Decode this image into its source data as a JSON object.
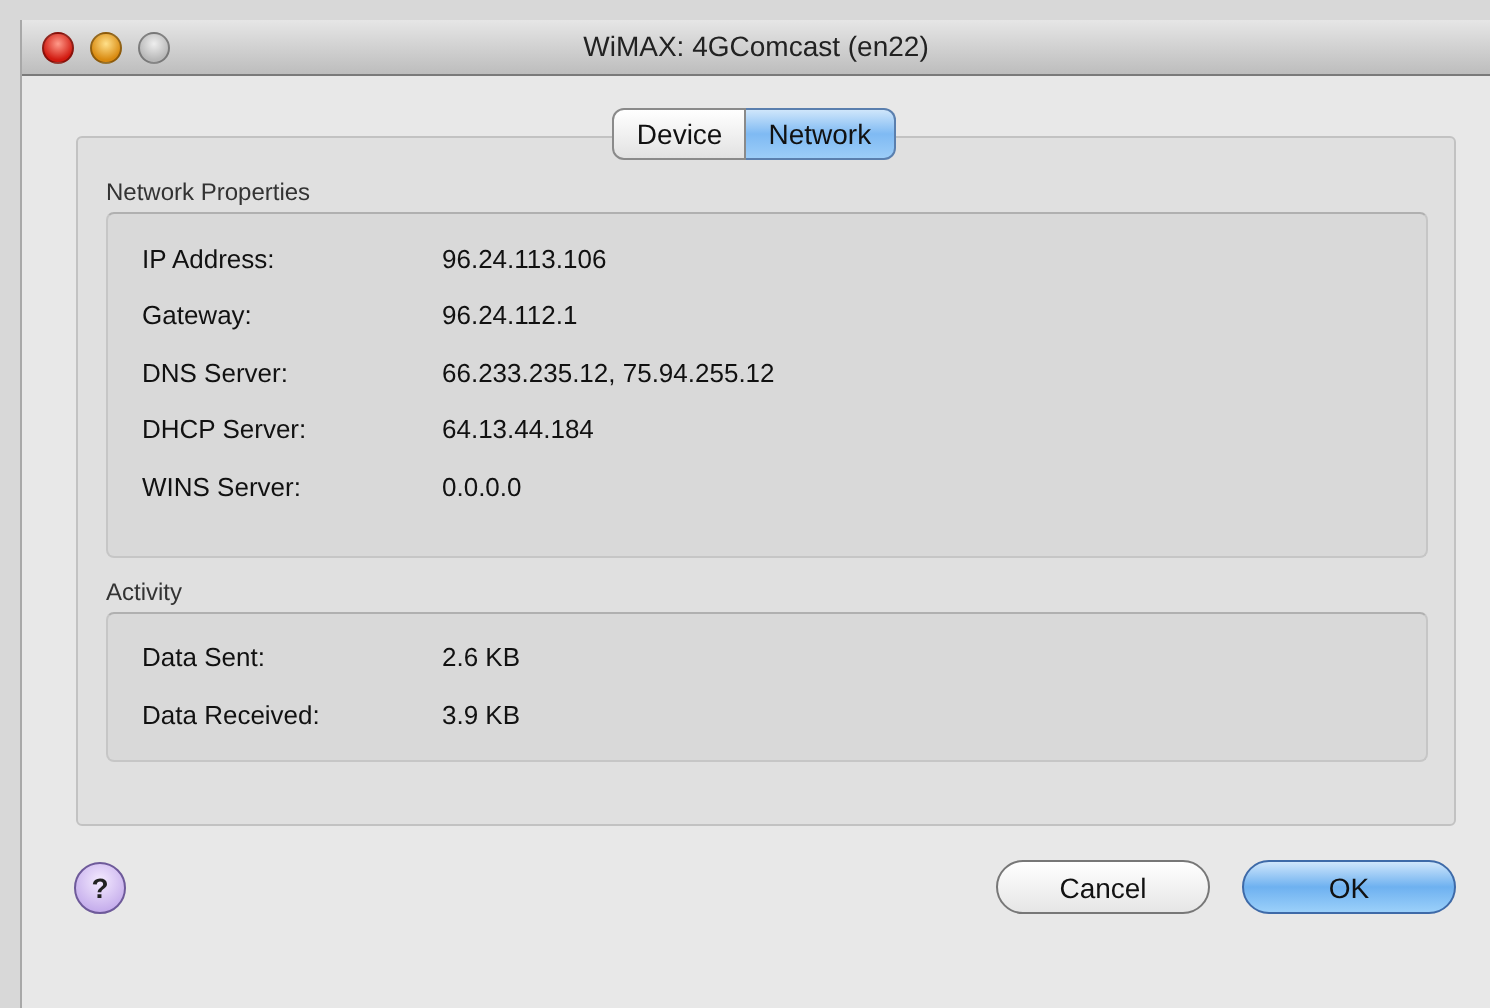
{
  "window": {
    "title": "WiMAX: 4GComcast (en22)"
  },
  "tabs": [
    {
      "label": "Device",
      "selected": false
    },
    {
      "label": "Network",
      "selected": true
    }
  ],
  "groups": [
    {
      "title": "Network Properties",
      "rows": [
        {
          "label": "IP Address:",
          "value": "96.24.113.106"
        },
        {
          "label": "Gateway:",
          "value": "96.24.112.1"
        },
        {
          "label": "DNS Server:",
          "value": "66.233.235.12, 75.94.255.12"
        },
        {
          "label": "DHCP Server:",
          "value": "64.13.44.184"
        },
        {
          "label": "WINS Server:",
          "value": "0.0.0.0"
        }
      ]
    },
    {
      "title": "Activity",
      "rows": [
        {
          "label": "Data Sent:",
          "value": "2.6 KB"
        },
        {
          "label": "Data Received:",
          "value": "3.9 KB"
        }
      ]
    }
  ],
  "help": "?",
  "buttons": [
    {
      "label": "Cancel",
      "default": false
    },
    {
      "label": "OK",
      "default": true
    }
  ]
}
